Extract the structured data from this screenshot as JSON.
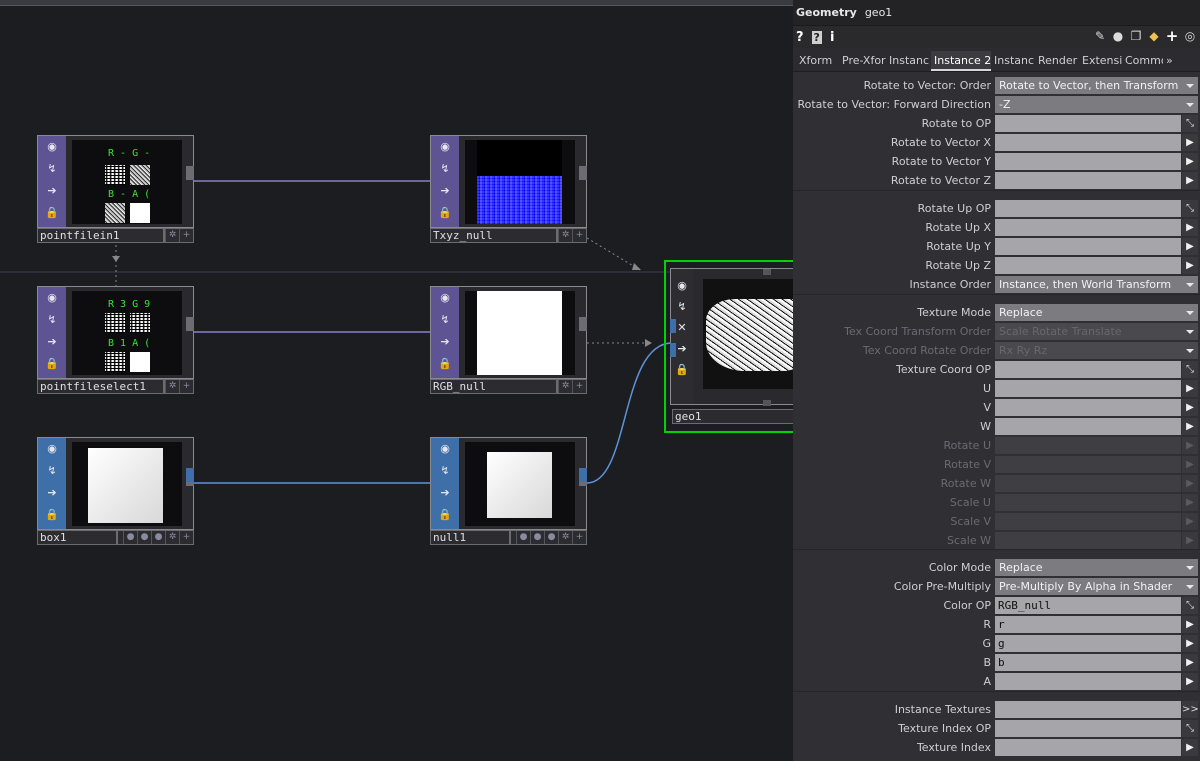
{
  "network": {
    "nodes": {
      "pointfilein1": {
        "name": "pointfilein1",
        "channels": [
          "R - G -",
          "B - A ("
        ]
      },
      "pointfileselect1": {
        "name": "pointfileselect1",
        "channels": [
          "R 3 G 9",
          "B 1 A ("
        ]
      },
      "box1": {
        "name": "box1"
      },
      "txyz_null": {
        "name": "Txyz_null"
      },
      "rgb_null": {
        "name": "RGB_null"
      },
      "null1": {
        "name": "null1"
      },
      "geo1": {
        "name": "geo1"
      }
    },
    "colors": {
      "comp": "#3f6fa8",
      "top": "#5e5494",
      "selected": "#00d400",
      "wire_blue": "#5e93d8",
      "wire_purple": "#8a80c8"
    }
  },
  "panel": {
    "type": "Geometry",
    "op_name": "geo1",
    "toolbar_icons": [
      "help-icon",
      "python-help-icon",
      "info-icon",
      "pencil-icon",
      "comment-icon",
      "copy-icon",
      "python-icon",
      "add-icon",
      "target-icon"
    ],
    "tabs": [
      "Xform",
      "Pre-Xfor",
      "Instanc",
      "Instance 2",
      "Instanc",
      "Render",
      "Extensio",
      "Commo",
      "»"
    ],
    "active_tab": "Instance 2",
    "rows": [
      {
        "label": "Rotate to Vector: Order",
        "kind": "menu",
        "value": "Rotate to Vector, then Transform"
      },
      {
        "label": "Rotate to Vector: Forward Direction",
        "kind": "menu",
        "value": "-Z"
      },
      {
        "label": "Rotate to OP",
        "kind": "op",
        "value": ""
      },
      {
        "label": "Rotate to Vector X",
        "kind": "field",
        "value": ""
      },
      {
        "label": "Rotate to Vector Y",
        "kind": "field",
        "value": ""
      },
      {
        "label": "Rotate to Vector Z",
        "kind": "field",
        "value": ""
      },
      {
        "label": "Rotate Up OP",
        "kind": "op",
        "value": ""
      },
      {
        "label": "Rotate Up X",
        "kind": "field",
        "value": ""
      },
      {
        "label": "Rotate Up Y",
        "kind": "field",
        "value": ""
      },
      {
        "label": "Rotate Up Z",
        "kind": "field",
        "value": ""
      },
      {
        "label": "Instance Order",
        "kind": "menu",
        "value": "Instance, then World Transform"
      },
      {
        "label": "Texture Mode",
        "kind": "menu",
        "value": "Replace"
      },
      {
        "label": "Tex Coord Transform Order",
        "kind": "menu",
        "value": "Scale Rotate Translate",
        "disabled": true
      },
      {
        "label": "Tex Coord Rotate Order",
        "kind": "menu",
        "value": "Rx Ry Rz",
        "disabled": true
      },
      {
        "label": "Texture Coord OP",
        "kind": "op",
        "value": ""
      },
      {
        "label": "U",
        "kind": "field",
        "value": ""
      },
      {
        "label": "V",
        "kind": "field",
        "value": ""
      },
      {
        "label": "W",
        "kind": "field",
        "value": ""
      },
      {
        "label": "Rotate U",
        "kind": "field",
        "value": "",
        "disabled": true
      },
      {
        "label": "Rotate V",
        "kind": "field",
        "value": "",
        "disabled": true
      },
      {
        "label": "Rotate W",
        "kind": "field",
        "value": "",
        "disabled": true
      },
      {
        "label": "Scale U",
        "kind": "field",
        "value": "",
        "disabled": true
      },
      {
        "label": "Scale V",
        "kind": "field",
        "value": "",
        "disabled": true
      },
      {
        "label": "Scale W",
        "kind": "field",
        "value": "",
        "disabled": true
      },
      {
        "label": "Color Mode",
        "kind": "menu",
        "value": "Replace"
      },
      {
        "label": "Color Pre-Multiply",
        "kind": "menu",
        "value": "Pre-Multiply By Alpha in Shader"
      },
      {
        "label": "Color OP",
        "kind": "op",
        "value": "RGB_null"
      },
      {
        "label": "R",
        "kind": "field",
        "value": "r"
      },
      {
        "label": "G",
        "kind": "field",
        "value": "g"
      },
      {
        "label": "B",
        "kind": "field",
        "value": "b"
      },
      {
        "label": "A",
        "kind": "field",
        "value": ""
      },
      {
        "label": "Instance Textures",
        "kind": "seq",
        "value": ""
      },
      {
        "label": "Texture Index OP",
        "kind": "op",
        "value": ""
      },
      {
        "label": "Texture Index",
        "kind": "field",
        "value": ""
      }
    ]
  }
}
